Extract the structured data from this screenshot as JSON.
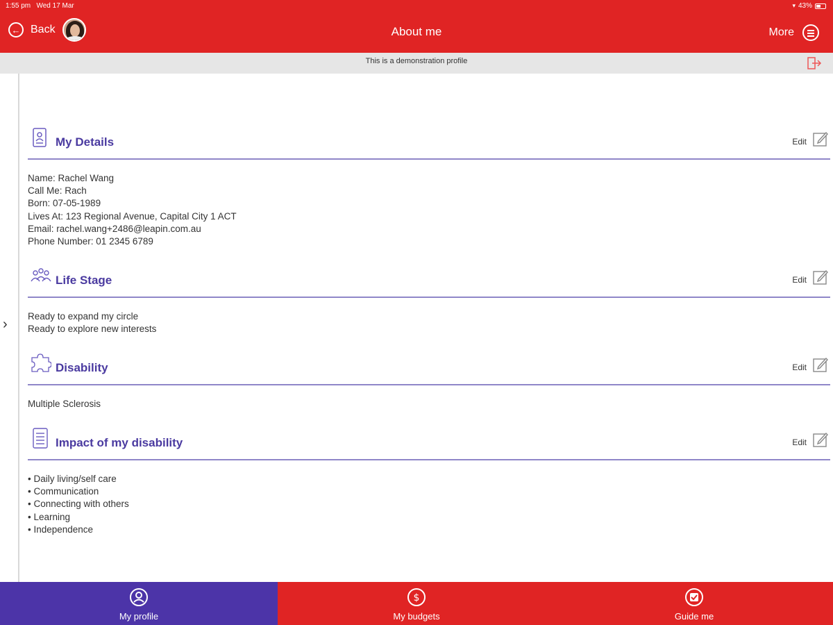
{
  "status": {
    "time": "1:55 pm",
    "date": "Wed 17 Mar",
    "battery": "43%"
  },
  "header": {
    "back_label": "Back",
    "title": "About me",
    "more_label": "More"
  },
  "demo_banner": "This is a demonstration profile",
  "sections": [
    {
      "title": "My Details",
      "edit_label": "Edit",
      "icon": "id-card-icon",
      "lines": [
        "Name: Rachel Wang",
        "Call Me: Rach",
        "Born: 07-05-1989",
        "Lives At: 123 Regional Avenue, Capital City 1 ACT",
        "Email: rachel.wang+2486@leapin.com.au",
        "Phone Number: 01 2345 6789"
      ]
    },
    {
      "title": "Life Stage",
      "edit_label": "Edit",
      "icon": "people-group-icon",
      "lines": [
        "Ready to expand my circle",
        "Ready to explore new interests"
      ]
    },
    {
      "title": "Disability",
      "edit_label": "Edit",
      "icon": "puzzle-icon",
      "lines": [
        "Multiple Sclerosis"
      ]
    },
    {
      "title": "Impact of my disability",
      "edit_label": "Edit",
      "icon": "document-list-icon",
      "lines": [
        "• Daily living/self care",
        "• Communication",
        "• Connecting with others",
        "• Learning",
        "• Independence"
      ]
    }
  ],
  "bottom_nav": [
    {
      "label": "My profile",
      "icon": "person-icon",
      "active": true
    },
    {
      "label": "My budgets",
      "icon": "dollar-icon",
      "active": false
    },
    {
      "label": "Guide me",
      "icon": "guide-icon",
      "active": false
    }
  ],
  "colors": {
    "primary_red": "#e02424",
    "accent_purple": "#4c34a8",
    "heading_purple": "#4a3aa0",
    "divider": "#8f86c8"
  }
}
